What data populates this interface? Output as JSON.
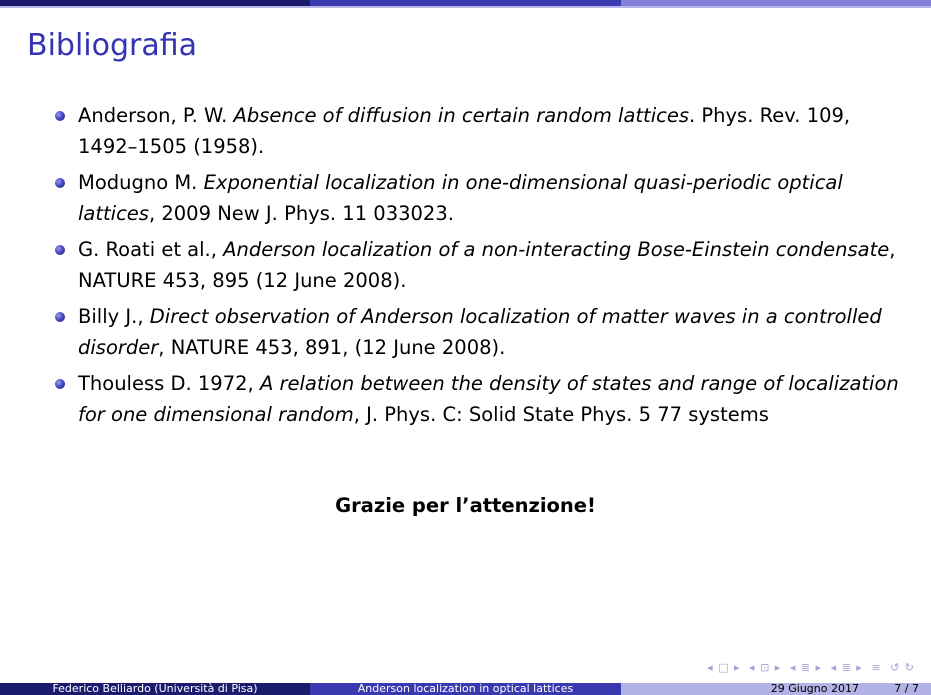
{
  "frame": {
    "title": "Bibliografia"
  },
  "references": [
    {
      "before": "Anderson, P. W. ",
      "title": "Absence of diffusion in certain random lattices",
      "after": ". Phys. Rev. 109, 1492–1505 (1958)."
    },
    {
      "before": "Modugno M. ",
      "title": "Exponential localization in one-dimensional quasi-periodic optical lattices",
      "after": ", 2009 New J. Phys. 11 033023."
    },
    {
      "before": "G. Roati et al., ",
      "title": "Anderson localization of a non-interacting Bose-Einstein condensate",
      "after": ", NATURE 453, 895 (12 June 2008)."
    },
    {
      "before": "Billy J., ",
      "title": "Direct observation of Anderson localization of matter waves in a controlled disorder",
      "after": ", NATURE 453, 891, (12 June 2008)."
    },
    {
      "before": "Thouless D. 1972, ",
      "title": "A relation between the density of states and range of localization for one dimensional random",
      "after": ", J. Phys. C: Solid State Phys. 5 77 systems"
    }
  ],
  "closing": "Grazie per l’attenzione!",
  "footer": {
    "author": "Federico Belliardo (Università di Pisa)",
    "talk_title": "Anderson localization in optical lattices",
    "date": "29 Giugno 2017",
    "page": "7 / 7"
  },
  "nav_icons": [
    "◂ □ ▸",
    "◂ ⊡ ▸",
    "◂ ≣ ▸",
    "◂ ≣ ▸",
    "≡",
    "↺ ↻"
  ],
  "colors": {
    "title": "#3333b3",
    "footer_dark": "#1b1b6e",
    "footer_mid": "#3a3ab0",
    "footer_light": "#b2b2e6"
  }
}
